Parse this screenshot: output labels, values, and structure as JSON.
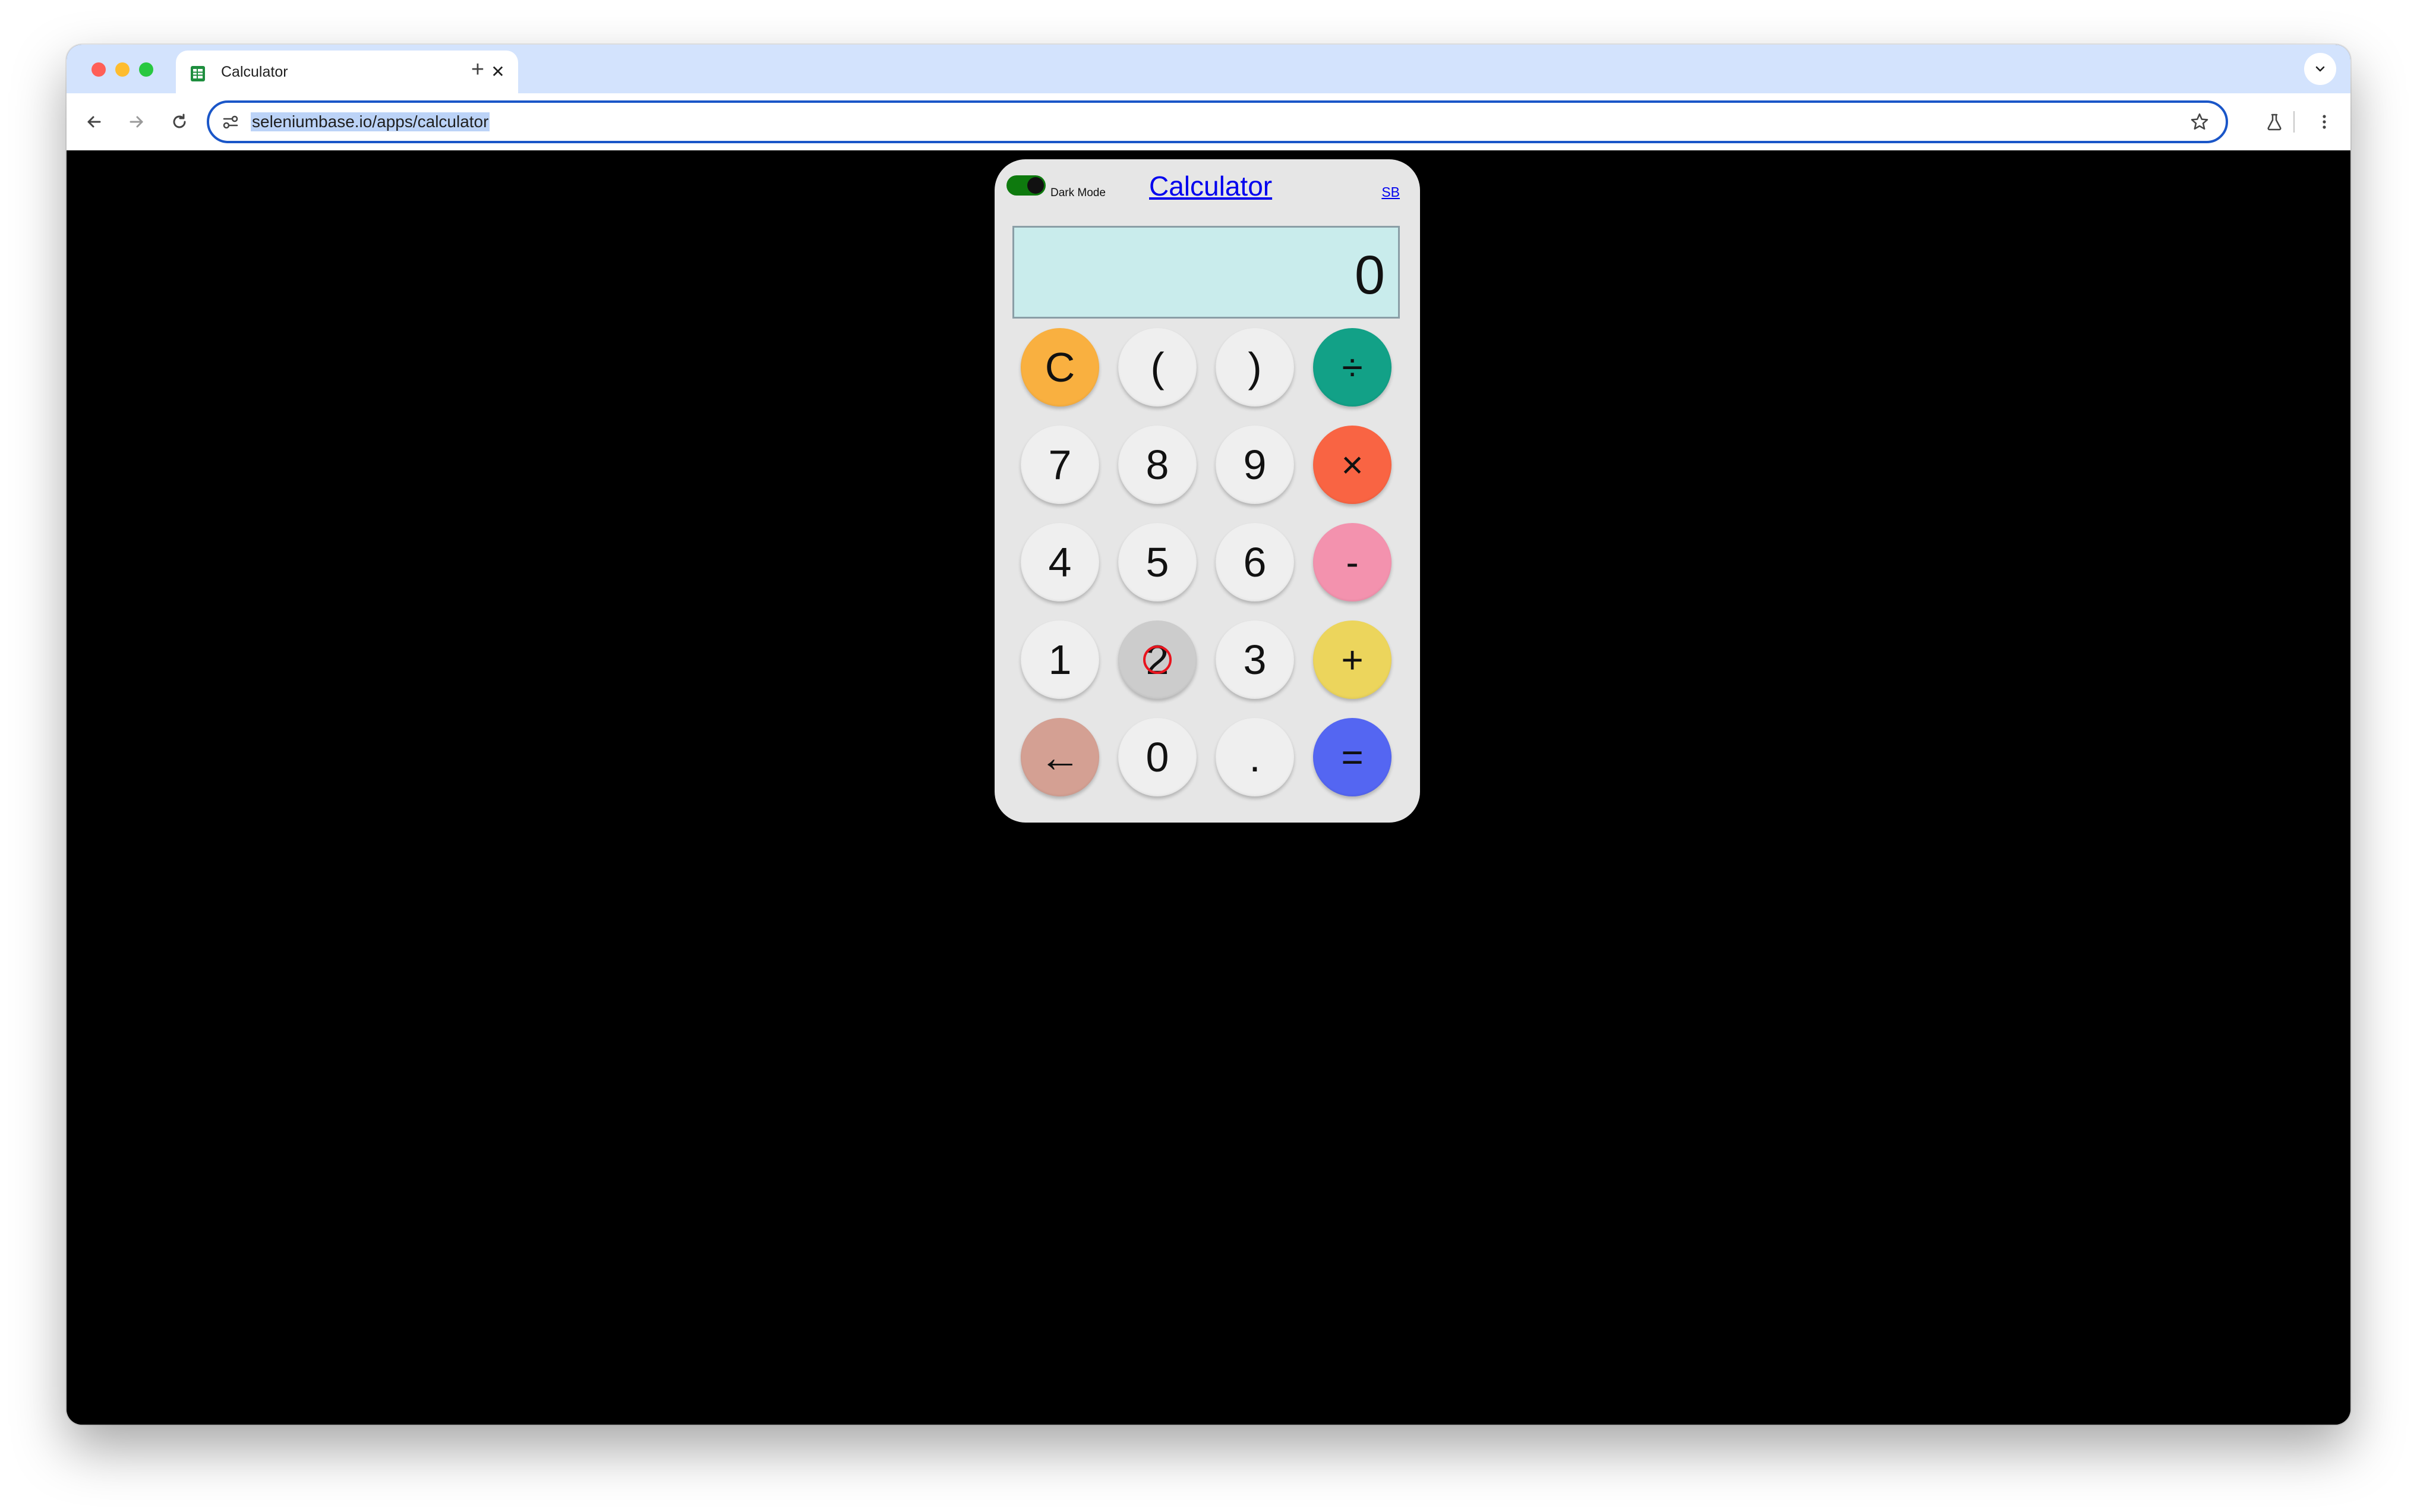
{
  "browser": {
    "tab_title": "Calculator",
    "url": "seleniumbase.io/apps/calculator",
    "close_glyph": "✕",
    "new_tab_glyph": "+"
  },
  "calculator": {
    "dark_mode_label": "Dark Mode",
    "dark_mode_on": true,
    "title": "Calculator",
    "sb_link": "SB",
    "display": "0",
    "keys": {
      "clear": "C",
      "lparen": "(",
      "rparen": ")",
      "divide": "÷",
      "k7": "7",
      "k8": "8",
      "k9": "9",
      "multiply": "×",
      "k4": "4",
      "k5": "5",
      "k6": "6",
      "minus": "-",
      "k1": "1",
      "k2": "2",
      "k3": "3",
      "plus": "+",
      "backspace": "←",
      "k0": "0",
      "decimal": ".",
      "equals": "="
    }
  },
  "colors": {
    "clear": "#f9b040",
    "divide": "#12a187",
    "multiply": "#f96443",
    "minus": "#f392ae",
    "plus": "#ecd55c",
    "backspace": "#d4a093",
    "equals": "#5466f2",
    "digit": "#efefef",
    "pressed": "#cccccc",
    "display_bg": "#c9ecec",
    "link": "#0000ee"
  },
  "icons": [
    "sheet-favicon-icon",
    "back-arrow-icon",
    "forward-arrow-icon",
    "reload-icon",
    "site-info-icon",
    "star-icon",
    "labs-flask-icon",
    "kebab-menu-icon",
    "chevron-down-icon"
  ]
}
